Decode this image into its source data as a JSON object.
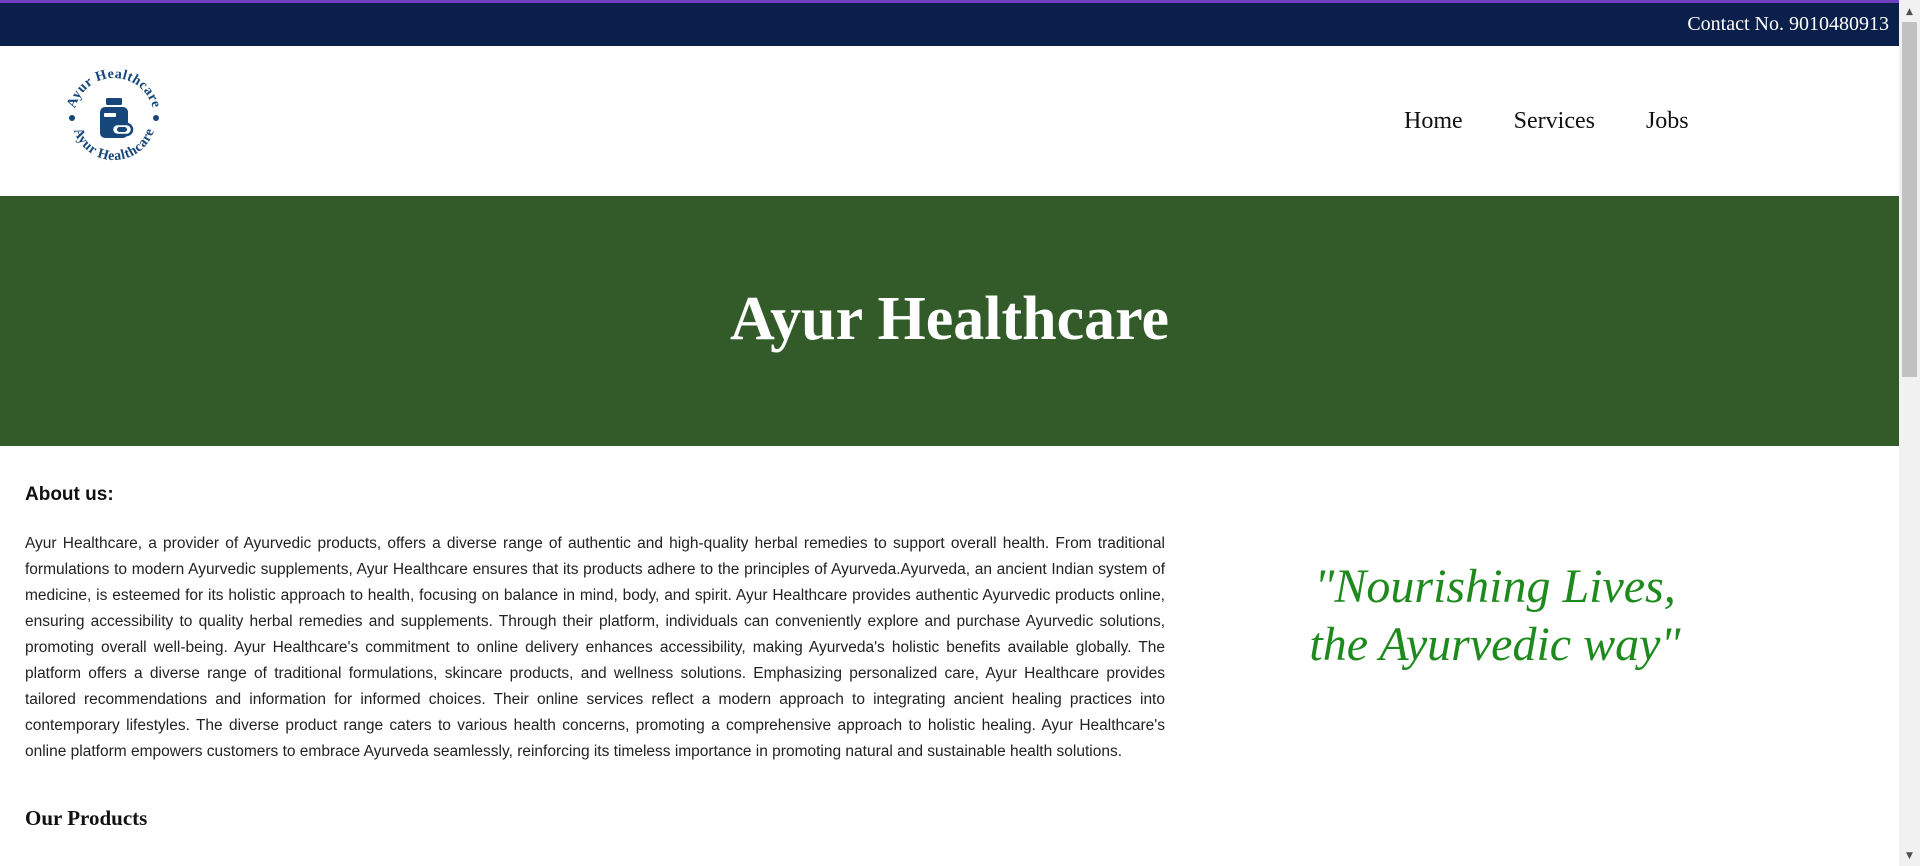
{
  "topbar": {
    "contact": "Contact No. 9010480913"
  },
  "logo": {
    "ring_text": "Ayur Healthcare"
  },
  "nav": {
    "items": [
      {
        "label": "Home"
      },
      {
        "label": "Services"
      },
      {
        "label": "Jobs"
      }
    ]
  },
  "hero": {
    "title": "Ayur Healthcare"
  },
  "about": {
    "heading": "About us:",
    "text": "Ayur Healthcare, a provider of Ayurvedic products, offers a diverse range of authentic and high-quality herbal remedies to support overall health. From traditional formulations to modern Ayurvedic supplements, Ayur Healthcare ensures that its products adhere to the principles of Ayurveda.Ayurveda, an ancient Indian system of medicine, is esteemed for its holistic approach to health, focusing on balance in mind, body, and spirit. Ayur Healthcare provides authentic Ayurvedic products online, ensuring accessibility to quality herbal remedies and supplements. Through their platform, individuals can conveniently explore and purchase Ayurvedic solutions, promoting overall well-being. Ayur Healthcare's commitment to online delivery enhances accessibility, making Ayurveda's holistic benefits available globally. The platform offers a diverse range of traditional formulations, skincare products, and wellness solutions. Emphasizing personalized care, Ayur Healthcare provides tailored recommendations and information for informed choices. Their online services reflect a modern approach to integrating ancient healing practices into contemporary lifestyles. The diverse product range caters to various health concerns, promoting a comprehensive approach to holistic healing. Ayur Healthcare's online platform empowers customers to embrace Ayurveda seamlessly, reinforcing its timeless importance in promoting natural and sustainable health solutions."
  },
  "quote": {
    "line1": "\"Nourishing Lives,",
    "line2": "the Ayurvedic way\""
  },
  "products": {
    "heading": "Our Products"
  },
  "colors": {
    "accent_line": "#6f3fc1",
    "topbar_bg": "#0b1f4b",
    "hero_bg": "#335b2a",
    "quote_text": "#1e8a1e",
    "logo_blue": "#17467a"
  }
}
